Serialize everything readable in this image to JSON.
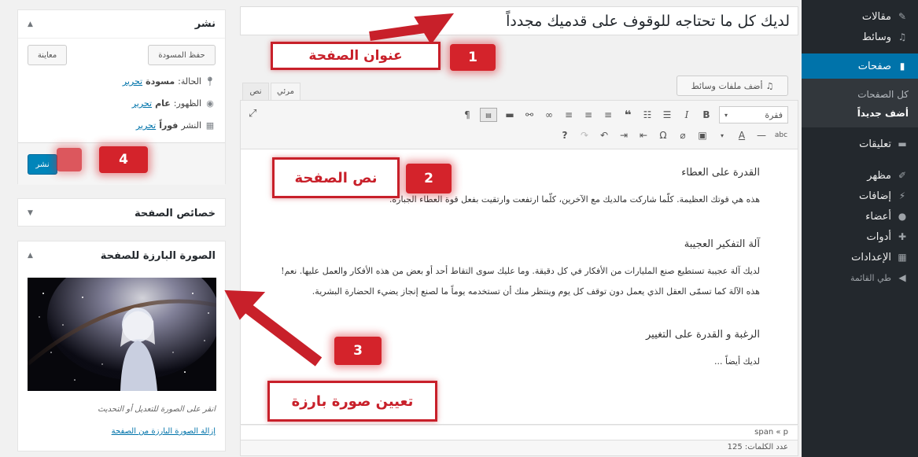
{
  "sidebar": {
    "items": [
      {
        "label": "مقالات",
        "icon": "pin-icon"
      },
      {
        "label": "وسائط",
        "icon": "media-icon"
      },
      {
        "label": "صفحات",
        "icon": "pages-icon",
        "active": true
      },
      {
        "label": "تعليقات",
        "icon": "comments-icon"
      },
      {
        "label": "مظهر",
        "icon": "appearance-icon"
      },
      {
        "label": "إضافات",
        "icon": "plugins-icon"
      },
      {
        "label": "أعضاء",
        "icon": "users-icon"
      },
      {
        "label": "أدوات",
        "icon": "tools-icon"
      },
      {
        "label": "الإعدادات",
        "icon": "settings-icon"
      },
      {
        "label": "طي القائمة",
        "icon": "collapse-icon"
      }
    ],
    "submenu": [
      {
        "label": "كل الصفحات"
      },
      {
        "label": "أضف جديداً",
        "current": true
      }
    ]
  },
  "editor": {
    "title_value": "لديك كل ما تحتاجه للوقوف على قدميك مجدداً",
    "add_media_label": "أضف ملفات وسائط",
    "tab_visual": "مرئي",
    "tab_text": "نص",
    "format_value": "فقرة",
    "content": {
      "h1": "القدرة على العطاء",
      "p1": "هذه هي قوتك العظيمة. كلّما شاركت مالديك مع الآخرين، كلّما ارتفعت وارتقيت بفعل قوة العطاء الجبارة.",
      "h2": "آلة التفكير العجيبة",
      "p2": "لديك آلة عجيبة تستطيع صنع المليارات من الأفكار في كل دقيقة. وما عليك سوى التقاط أحد أو بعض من هذه الأفكار والعمل عليها. نعم! هذه الآلة كما تسمّى العقل الذي يعمل دون توقف كل يوم وينتظر منك أن تستخدمه يوماً ما لصنع إنجاز يضيء الحضارة البشرية.",
      "h3": "الرغبة و القدرة على التغيير",
      "p3": "لديك أيضاً ..."
    },
    "status_path": "span « p",
    "word_count": "عدد الكلمات: 125"
  },
  "publish": {
    "title": "نشر",
    "save_draft": "حفظ المسودة",
    "preview": "معاينة",
    "status_label": "الحالة:",
    "status_value": "مسودة",
    "visibility_label": "الظهور:",
    "visibility_value": "عام",
    "schedule_label": "النشر",
    "schedule_value": "فوراً",
    "edit_link": "تحرير",
    "publish_button": "نشر"
  },
  "attributes": {
    "title": "خصائص الصفحة"
  },
  "featured": {
    "title": "الصورة البارزة للصفحة",
    "hint": "انقر على الصورة للتعديل أو التحديث",
    "remove_link": "إزالة الصورة البارزة من الصفحة"
  },
  "annotations": {
    "a1": {
      "label": "عنوان الصفحة",
      "number": "1"
    },
    "a2": {
      "label": "نص الصفحة",
      "number": "2"
    },
    "a3": {
      "label": "تعيين صورة بارزة",
      "number": "3"
    },
    "a4": {
      "number": "4"
    }
  },
  "colors": {
    "sidebar_bg": "#23282d",
    "active_blue": "#0073aa",
    "annotation_red": "#c8202a"
  }
}
